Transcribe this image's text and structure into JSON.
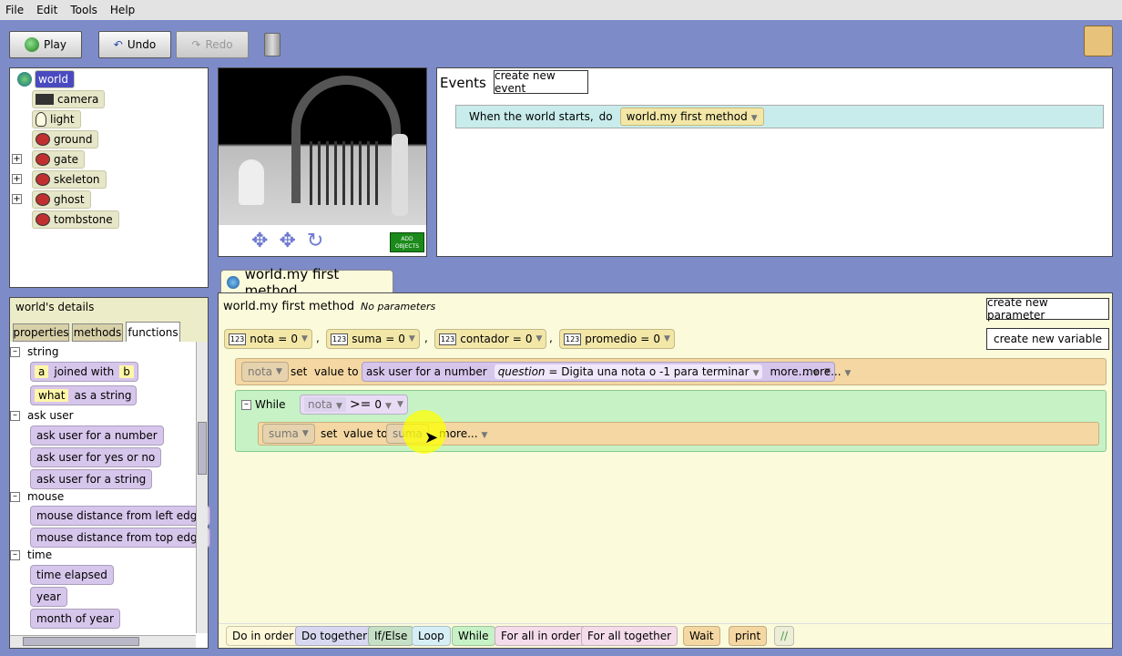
{
  "menu": [
    "File",
    "Edit",
    "Tools",
    "Help"
  ],
  "toolbar": {
    "play": "Play",
    "undo": "Undo",
    "redo": "Redo"
  },
  "tree": {
    "items": [
      {
        "label": "world"
      },
      {
        "label": "camera"
      },
      {
        "label": "light"
      },
      {
        "label": "ground"
      },
      {
        "label": "gate"
      },
      {
        "label": "skeleton"
      },
      {
        "label": "ghost"
      },
      {
        "label": "tombstone"
      }
    ]
  },
  "viewer": {
    "add_objects": "ADD OBJECTS"
  },
  "events": {
    "title": "Events",
    "create_button": "create new event",
    "event_when": "When the world starts,",
    "event_do": "do",
    "event_method": "world.my first method"
  },
  "details": {
    "title": "world's details",
    "tabs": [
      "properties",
      "methods",
      "functions"
    ],
    "sections": {
      "string": "string",
      "joined_a": "a",
      "joined_mid": "joined with",
      "joined_b": "b",
      "as_string_what": "what",
      "as_string": "as a string",
      "ask_user": "ask user",
      "ask_number": "ask user for a number",
      "ask_yesno": "ask user for yes or no",
      "ask_string": "ask user for a string",
      "mouse": "mouse",
      "mouse_left": "mouse distance from left edge",
      "mouse_top": "mouse distance from top edge",
      "time": "time",
      "time_elapsed": "time elapsed",
      "year": "year",
      "month": "month of year"
    }
  },
  "editor": {
    "tab_title": "world.my first method",
    "method_name": "world.my first method",
    "no_params": "No parameters",
    "create_param": "create new parameter",
    "create_var": "create new variable",
    "variables": [
      {
        "icon": "123",
        "name": "nota",
        "value": "0"
      },
      {
        "icon": "123",
        "name": "suma",
        "value": "0"
      },
      {
        "icon": "123",
        "name": "contador",
        "value": "0"
      },
      {
        "icon": "123",
        "name": "promedio",
        "value": "0"
      }
    ],
    "comma": ",",
    "equals": "=",
    "line1": {
      "var": "nota",
      "set": "set",
      "value_to": "value to",
      "func": "ask user for a number",
      "question_label": "question",
      "question_value": "= Digita una nota o -1 para terminar",
      "more_inner": "more...",
      "more_outer": "more..."
    },
    "while": {
      "label": "While",
      "left": "nota",
      "op": ">=",
      "right": "0"
    },
    "line2": {
      "var": "suma",
      "set": "set",
      "value_to": "value to",
      "value": "suma",
      "more": "more..."
    }
  },
  "bottom_bar": [
    "Do in order",
    "Do together",
    "If/Else",
    "Loop",
    "While",
    "For all in order",
    "For all together",
    "Wait",
    "print",
    "//"
  ]
}
